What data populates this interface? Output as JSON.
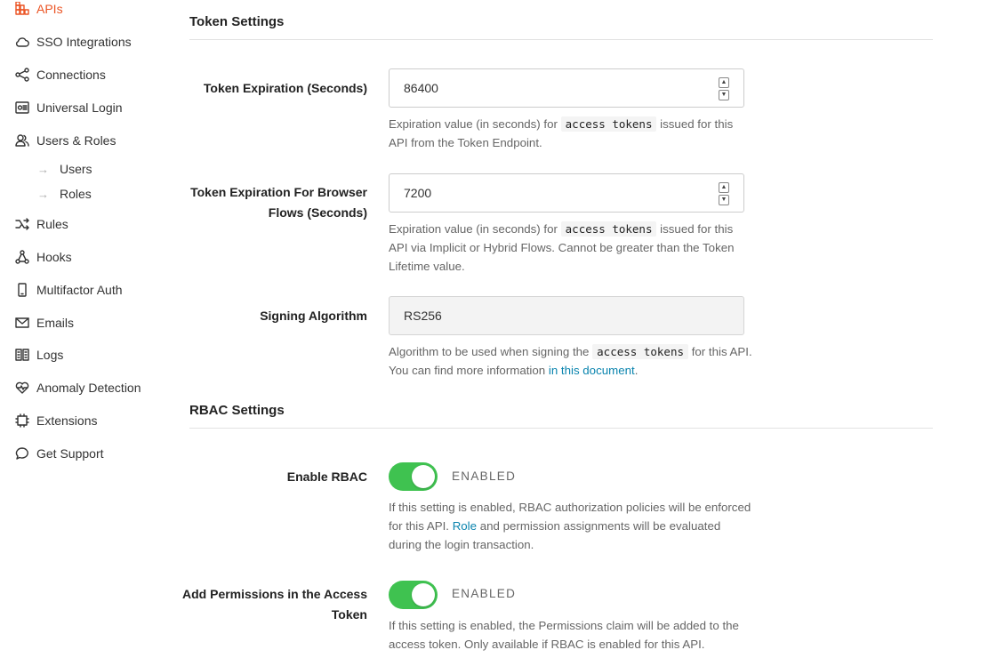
{
  "sidebar": {
    "items": [
      {
        "label": "APIs",
        "icon": "apis-icon",
        "active": true
      },
      {
        "label": "SSO Integrations",
        "icon": "cloud-icon"
      },
      {
        "label": "Connections",
        "icon": "connections-icon"
      },
      {
        "label": "Universal Login",
        "icon": "universal-login-icon"
      },
      {
        "label": "Users & Roles",
        "icon": "users-icon"
      },
      {
        "label": "Users",
        "sub": true
      },
      {
        "label": "Roles",
        "sub": true
      },
      {
        "label": "Rules",
        "icon": "rules-icon"
      },
      {
        "label": "Hooks",
        "icon": "hooks-icon"
      },
      {
        "label": "Multifactor Auth",
        "icon": "phone-icon"
      },
      {
        "label": "Emails",
        "icon": "mail-icon"
      },
      {
        "label": "Logs",
        "icon": "logs-icon"
      },
      {
        "label": "Anomaly Detection",
        "icon": "heart-pulse-icon"
      },
      {
        "label": "Extensions",
        "icon": "chip-icon"
      },
      {
        "label": "Get Support",
        "icon": "chat-bubble-icon"
      }
    ]
  },
  "token_settings": {
    "title": "Token Settings",
    "expiration_label": "Token Expiration (Seconds)",
    "expiration_value": "86400",
    "expiration_help_pre": "Expiration value (in seconds) for ",
    "expiration_help_code": "access tokens",
    "expiration_help_post": " issued for this API from the Token Endpoint.",
    "browser_label_line1": "Token Expiration For Browser",
    "browser_label_line2": "Flows (Seconds)",
    "browser_value": "7200",
    "browser_help_pre": "Expiration value (in seconds) for ",
    "browser_help_code": "access tokens",
    "browser_help_post": " issued for this API via Implicit or Hybrid Flows. Cannot be greater than the Token Lifetime value.",
    "signing_label": "Signing Algorithm",
    "signing_value": "RS256",
    "signing_help_pre": "Algorithm to be used when signing the ",
    "signing_help_code": "access tokens",
    "signing_help_mid": " for this API. You can find more information ",
    "signing_help_link": "in this document",
    "signing_help_post": "."
  },
  "rbac_settings": {
    "title": "RBAC Settings",
    "enable_label": "Enable RBAC",
    "enable_state": "ENABLED",
    "enable_on": true,
    "enable_help_pre": "If this setting is enabled, RBAC authorization policies will be enforced for this API. ",
    "enable_help_link": "Role",
    "enable_help_post": " and permission assignments will be evaluated during the login transaction.",
    "perm_label_line1": "Add Permissions in the Access",
    "perm_label_line2": "Token",
    "perm_state": "ENABLED",
    "perm_on": true,
    "perm_help": "If this setting is enabled, the Permissions claim will be added to the access token. Only available if RBAC is enabled for this API."
  },
  "colors": {
    "accent": "#eb5424",
    "toggle_on": "#3fc250",
    "link": "#0a84ae"
  }
}
